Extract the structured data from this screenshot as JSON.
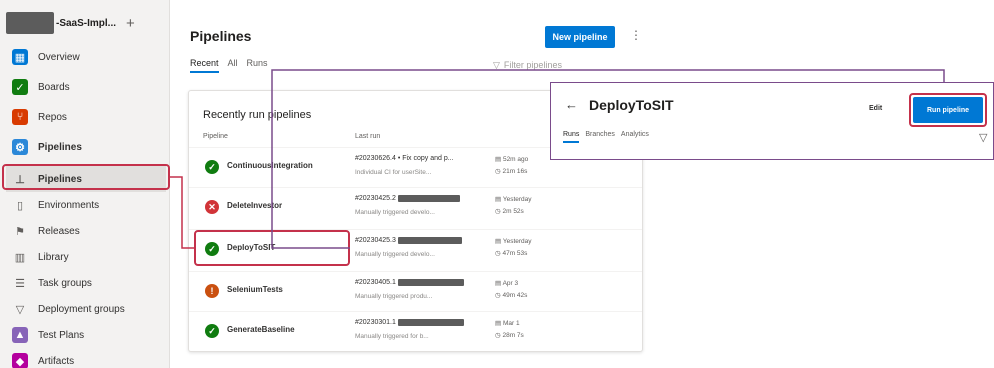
{
  "project": {
    "name": "-SaaS-Impl...",
    "add": "+"
  },
  "nav": [
    {
      "label": "Overview"
    },
    {
      "label": "Boards"
    },
    {
      "label": "Repos"
    },
    {
      "label": "Pipelines"
    },
    {
      "label": "Pipelines"
    },
    {
      "label": "Environments"
    },
    {
      "label": "Releases"
    },
    {
      "label": "Library"
    },
    {
      "label": "Task groups"
    },
    {
      "label": "Deployment groups"
    },
    {
      "label": "Test Plans"
    },
    {
      "label": "Artifacts"
    }
  ],
  "page": {
    "title": "Pipelines",
    "new_button": "New pipeline",
    "more": "⋮",
    "tabs": [
      "Recent",
      "All",
      "Runs"
    ],
    "filter_placeholder": "Filter pipelines"
  },
  "card": {
    "title": "Recently run pipelines",
    "col_pipeline": "Pipeline",
    "col_lastrun": "Last run"
  },
  "rows": [
    {
      "name": "ContinuousIntegration",
      "status": "success",
      "run": "#20230626.4 • Fix copy and p...",
      "trigger": "Individual CI for",
      "user": "userSite...",
      "d1": "52m ago",
      "d2": "21m 16s"
    },
    {
      "name": "DeleteInvestor",
      "status": "failed",
      "run": "#20230425.2",
      "trigger": "Manually triggered",
      "user": "develo...",
      "d1": "Yesterday",
      "d2": "2m 52s"
    },
    {
      "name": "DeployToSIT",
      "status": "success",
      "run": "#20230425.3",
      "trigger": "Manually triggered",
      "user": "develo...",
      "d1": "Yesterday",
      "d2": "47m 53s"
    },
    {
      "name": "SeleniumTests",
      "status": "warning",
      "run": "#20230405.1",
      "trigger": "Manually triggered",
      "user": "produ...",
      "d1": "Apr 3",
      "d2": "49m 42s"
    },
    {
      "name": "GenerateBaseline",
      "status": "success",
      "run": "#20230301.1",
      "trigger": "Manually triggered for",
      "user": "b...",
      "d1": "Mar 1",
      "d2": "28m 7s"
    }
  ],
  "zoom": {
    "back": "←",
    "title": "DeployToSIT",
    "edit": "Edit",
    "run_button": "Run pipeline",
    "tabs": [
      "Runs",
      "Branches",
      "Analytics"
    ],
    "filter": "▽"
  },
  "colors": {
    "accent": "#0078d4",
    "success": "#107c10",
    "failed": "#d13438",
    "warning": "#ca5010",
    "annotation_red": "#c4314b",
    "annotation_purple": "#7a4b8b"
  }
}
